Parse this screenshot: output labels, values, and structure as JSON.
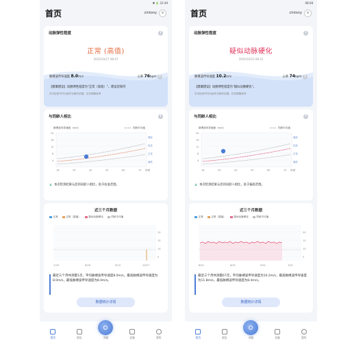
{
  "phones": [
    {
      "status_time": "▼ 🔋 22:49",
      "title": "首页",
      "username": "clntony",
      "elasticity": {
        "heading": "动脉弹性程度",
        "status": "正常 (高值)",
        "status_color": "#e36a3d",
        "timestamp": "2020/10/27 08:47",
        "pwv_label": "脉搏波传导速度",
        "pwv_value": "8.0",
        "pwv_unit": "m/s",
        "hr_label": "心率",
        "hr_value": "76",
        "hr_unit": "bpm",
        "advice": "【健康建议】动脉弹性程度为\"正常（高值）\"，建议您保持",
        "note": "本次检测不作为医学诊断的依据，仅供健康参考"
      },
      "peer": {
        "heading": "与同龄人相比",
        "ylabel": "脉搏波传导速度（m/s）",
        "legend_label": "同龄平均值",
        "yticks": [
          "20",
          "16",
          "12",
          "8",
          "4"
        ],
        "xticks": [
          "18",
          "30",
          "40",
          "50",
          "60",
          "70"
        ],
        "xunit": "年龄",
        "zones": [
          "偏高",
          "较高",
          "正常",
          "偏低"
        ],
        "result": "本次检测结果与您的同龄人相比，处于标准范围。"
      },
      "recent": {
        "heading": "近三个月数据",
        "legend": [
          "正常",
          "正常（高值）",
          "疑似动脉硬化",
          "同龄平均值"
        ],
        "yticks": [
          "20",
          "15",
          "10",
          "5"
        ],
        "dates": [
          "7/29",
          "8/26",
          "9/15",
          "10/27"
        ],
        "summary": "最近三个月共测量1次，平均脉搏波传导速度8.0m/s，最高脉搏波传导速度为8.0m/s，最低脉搏波传导速度为8.0m/s。",
        "button": "数据统计详情"
      },
      "nav": [
        "首页",
        "报告",
        "测量",
        "设备",
        "我的"
      ]
    },
    {
      "status_time": "08:08",
      "title": "首页",
      "username": "clntony",
      "elasticity": {
        "heading": "动脉弹性程度",
        "status": "疑似动脉硬化",
        "status_color": "#e0325a",
        "timestamp": "2020/10/23 08:12",
        "pwv_label": "脉搏波传导速度",
        "pwv_value": "10.2",
        "pwv_unit": "m/s",
        "hr_label": "心率",
        "hr_value": "74",
        "hr_unit": "bpm",
        "advice": "【健康建议】动脉弹性程度为\"疑似动脉硬化\"，",
        "note": "本次检测不作为医学诊断的依据，仅供健康参考"
      },
      "peer": {
        "heading": "与同龄人相比",
        "ylabel": "脉搏波传导速度（m/s）",
        "legend_label": "同龄平均值",
        "yticks": [
          "20",
          "16",
          "12",
          "8",
          "4"
        ],
        "xticks": [
          "18",
          "30",
          "40",
          "50",
          "60",
          "70"
        ],
        "xunit": "年龄",
        "zones": [
          "偏高",
          "较高",
          "正常",
          "偏低"
        ],
        "result": "本次检测结果与您的同龄人相比，处于偏高范围。"
      },
      "recent": {
        "heading": "近三个月数据",
        "legend": [
          "正常",
          "正常（高值）",
          "疑似动脉硬化",
          "同龄平均值"
        ],
        "yticks": [
          "20",
          "15",
          "10",
          "5"
        ],
        "dates": [
          "8/01",
          "8/31",
          "9/01",
          "7/01"
        ],
        "summary": "最近三个月共测量67次，平均脉搏波传导速度为10.2m/s，最高脉搏波传导速度为11.8m/s，最低脉搏波传导速度为8.4m/s。",
        "button": "数据统计详情"
      },
      "nav": [
        "首页",
        "报告",
        "测量",
        "设备",
        "我的"
      ]
    }
  ]
}
